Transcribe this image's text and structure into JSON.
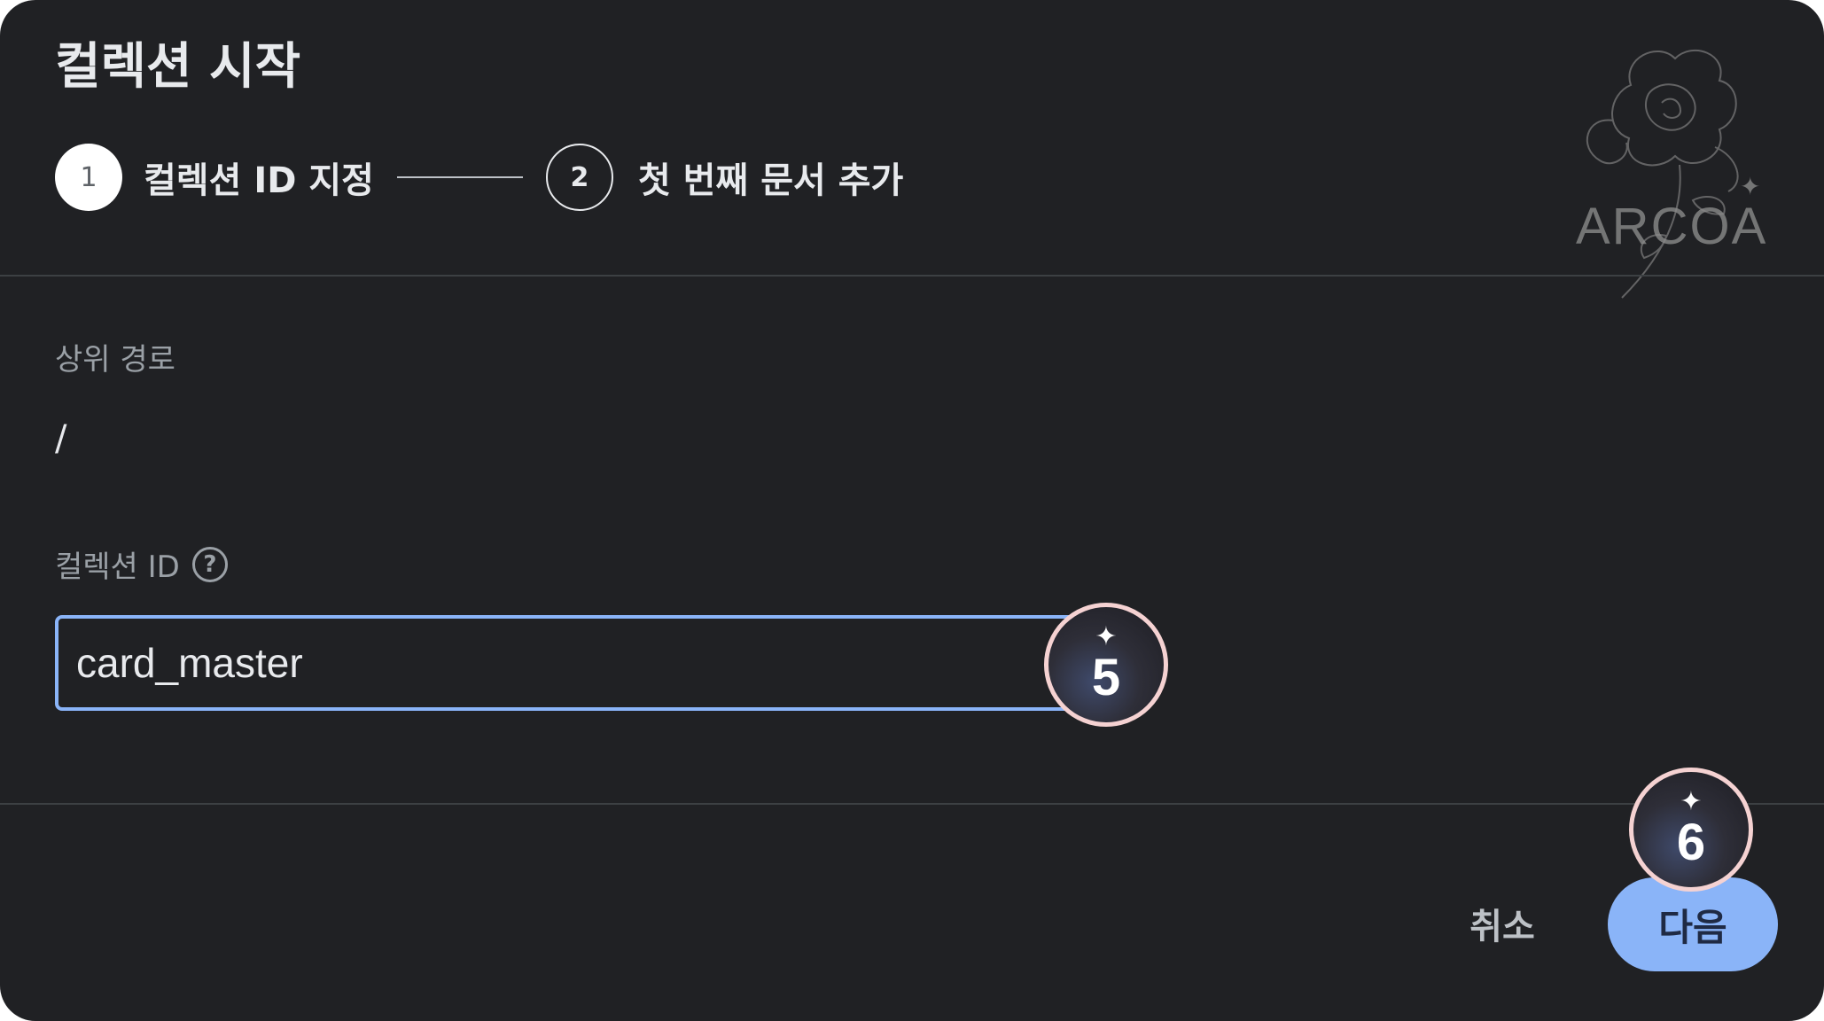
{
  "dialog": {
    "title": "컬렉션 시작"
  },
  "stepper": {
    "steps": [
      {
        "number": "1",
        "label": "컬렉션 ID 지정",
        "state": "active"
      },
      {
        "number": "2",
        "label": "첫 번째 문서 추가",
        "state": "inactive"
      }
    ]
  },
  "form": {
    "parent_path_label": "상위 경로",
    "parent_path_value": "/",
    "collection_id_label": "컬렉션 ID",
    "help_icon": "help-circle-icon",
    "help_symbol": "?",
    "collection_id_value": "card_master"
  },
  "footer": {
    "cancel_label": "취소",
    "next_label": "다음"
  },
  "annotations": {
    "badge_5": {
      "sparkle": "✦",
      "number": "5"
    },
    "badge_6": {
      "sparkle": "✦",
      "number": "6"
    }
  },
  "watermark": {
    "text": "ARCOA",
    "star": "✦",
    "icon": "peony-flower-icon"
  },
  "colors": {
    "background": "#202124",
    "accent": "#8ab4f8",
    "badge_ring": "#f5d2d2"
  }
}
